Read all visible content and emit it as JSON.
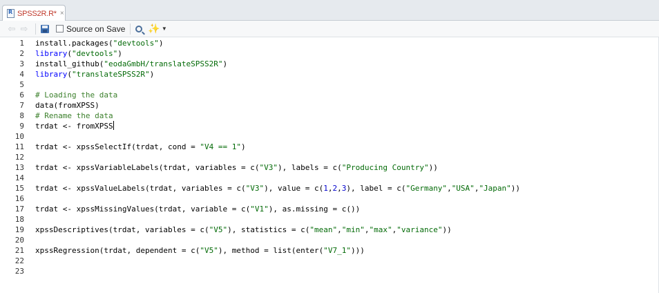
{
  "tab": {
    "title": "SPSS2R.R*",
    "close": "×"
  },
  "toolbar": {
    "back_icon": "back-arrow-icon",
    "forward_icon": "forward-arrow-icon",
    "save_icon": "save-icon",
    "source_on_save_label": "Source on Save",
    "source_on_save_checked": false,
    "search_icon": "search-icon",
    "wand_icon": "magic-wand-icon"
  },
  "editor": {
    "line_numbers": [
      "1",
      "2",
      "3",
      "4",
      "5",
      "6",
      "7",
      "8",
      "9",
      "10",
      "11",
      "12",
      "13",
      "14",
      "15",
      "16",
      "17",
      "18",
      "19",
      "20",
      "21",
      "22",
      "23"
    ],
    "lines": [
      [
        [
          "fn",
          "install.packages("
        ],
        [
          "str",
          "\"devtools\""
        ],
        [
          "fn",
          ")"
        ]
      ],
      [
        [
          "kw",
          "library"
        ],
        [
          "fn",
          "("
        ],
        [
          "str",
          "\"devtools\""
        ],
        [
          "fn",
          ")"
        ]
      ],
      [
        [
          "fn",
          "install_github("
        ],
        [
          "str",
          "\"eodaGmbH/translateSPSS2R\""
        ],
        [
          "fn",
          ")"
        ]
      ],
      [
        [
          "kw",
          "library"
        ],
        [
          "fn",
          "("
        ],
        [
          "str",
          "\"translateSPSS2R\""
        ],
        [
          "fn",
          ")"
        ]
      ],
      [],
      [
        [
          "cm",
          "# Loading the data"
        ]
      ],
      [
        [
          "fn",
          "data(fromXPSS)"
        ]
      ],
      [
        [
          "cm",
          "# Rename the data"
        ]
      ],
      [
        [
          "fn",
          "trdat <- fromXPSS"
        ]
      ],
      [],
      [
        [
          "fn",
          "trdat <- xpssSelectIf(trdat, cond = "
        ],
        [
          "str",
          "\"V4 == 1\""
        ],
        [
          "fn",
          ")"
        ]
      ],
      [],
      [
        [
          "fn",
          "trdat <- xpssVariableLabels(trdat, variables = c("
        ],
        [
          "str",
          "\"V3\""
        ],
        [
          "fn",
          "), labels = c("
        ],
        [
          "str",
          "\"Producing Country\""
        ],
        [
          "fn",
          "))"
        ]
      ],
      [],
      [
        [
          "fn",
          "trdat <- xpssValueLabels(trdat, variables = c("
        ],
        [
          "str",
          "\"V3\""
        ],
        [
          "fn",
          "), value = c("
        ],
        [
          "num",
          "1"
        ],
        [
          "fn",
          ","
        ],
        [
          "num",
          "2"
        ],
        [
          "fn",
          ","
        ],
        [
          "num",
          "3"
        ],
        [
          "fn",
          "), label = c("
        ],
        [
          "str",
          "\"Germany\""
        ],
        [
          "fn",
          ","
        ],
        [
          "str",
          "\"USA\""
        ],
        [
          "fn",
          ","
        ],
        [
          "str",
          "\"Japan\""
        ],
        [
          "fn",
          "))"
        ]
      ],
      [],
      [
        [
          "fn",
          "trdat <- xpssMissingValues(trdat, variable = c("
        ],
        [
          "str",
          "\"V1\""
        ],
        [
          "fn",
          "), as.missing = c())"
        ]
      ],
      [],
      [
        [
          "fn",
          "xpssDescriptives(trdat, variables = c("
        ],
        [
          "str",
          "\"V5\""
        ],
        [
          "fn",
          "), statistics = c("
        ],
        [
          "str",
          "\"mean\""
        ],
        [
          "fn",
          ","
        ],
        [
          "str",
          "\"min\""
        ],
        [
          "fn",
          ","
        ],
        [
          "str",
          "\"max\""
        ],
        [
          "fn",
          ","
        ],
        [
          "str",
          "\"variance\""
        ],
        [
          "fn",
          "))"
        ]
      ],
      [],
      [
        [
          "fn",
          "xpssRegression(trdat, dependent = c("
        ],
        [
          "str",
          "\"V5\""
        ],
        [
          "fn",
          "), method = list(enter("
        ],
        [
          "str",
          "\"V7_1\""
        ],
        [
          "fn",
          ")))"
        ]
      ],
      [],
      []
    ],
    "cursor_line": 9
  }
}
